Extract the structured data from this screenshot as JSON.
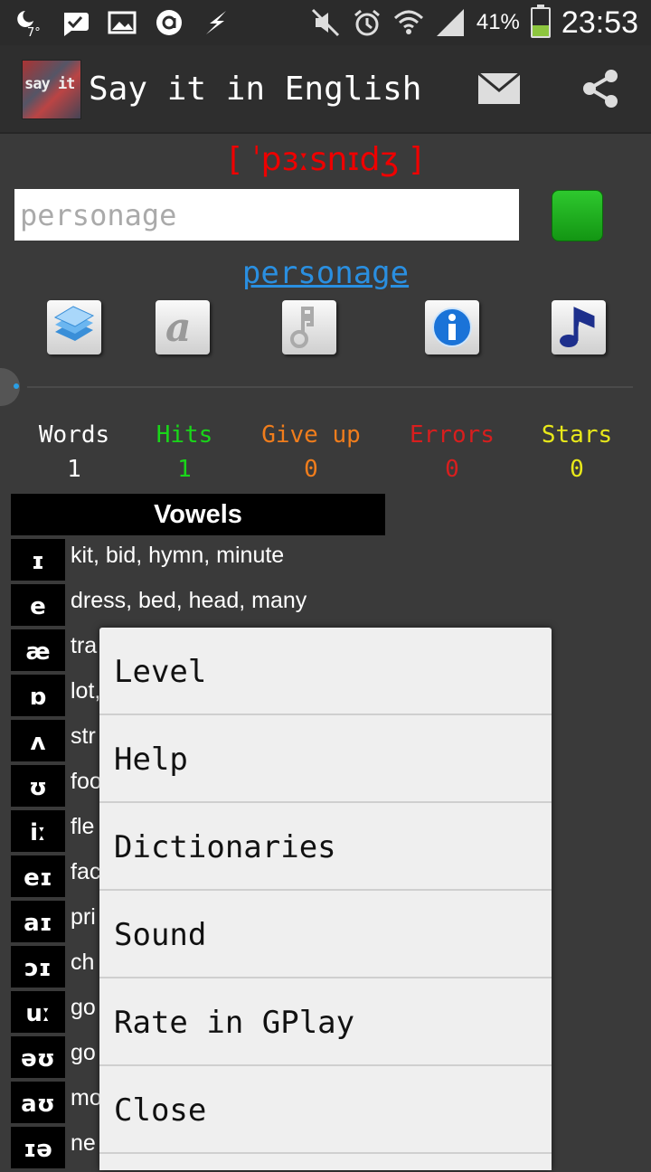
{
  "status_bar": {
    "temperature": "7°",
    "battery_percent": "41%",
    "battery_level": 0.41,
    "time": "23:53",
    "icons": [
      "weather-icon",
      "bbm-icon",
      "gallery-icon",
      "circle-a-icon",
      "flash-icon",
      "mute-icon",
      "alarm-icon",
      "wifi-icon",
      "signal-icon",
      "battery-icon"
    ]
  },
  "action_bar": {
    "logo_text": "say it",
    "title": "Say it in English",
    "actions": [
      "mail-icon",
      "share-icon"
    ]
  },
  "main": {
    "ipa": "[ ˈpɜːsnɪdʒ ]",
    "input_value": "personage",
    "link_word": "personage",
    "tools": [
      "books-icon",
      "at-sign-icon",
      "key-icon",
      "info-icon",
      "music-note-icon"
    ]
  },
  "stats": [
    {
      "label": "Words",
      "value": "1",
      "color": "#ffffff"
    },
    {
      "label": "Hits",
      "value": "1",
      "color": "#19d619"
    },
    {
      "label": "Give up",
      "value": "0",
      "color": "#f07d1c"
    },
    {
      "label": "Errors",
      "value": "0",
      "color": "#d81e1e"
    },
    {
      "label": "Stars",
      "value": "0",
      "color": "#e8e81a"
    }
  ],
  "vowels": {
    "title": "Vowels",
    "rows": [
      {
        "symbol": "ɪ",
        "examples": "kit, bid, hymn, minute"
      },
      {
        "symbol": "e",
        "examples": "dress, bed, head, many"
      },
      {
        "symbol": "æ",
        "examples": "tra"
      },
      {
        "symbol": "ɒ",
        "examples": "lot,"
      },
      {
        "symbol": "ʌ",
        "examples": "str"
      },
      {
        "symbol": "ʊ",
        "examples": "foo"
      },
      {
        "symbol": "iː",
        "examples": "fle"
      },
      {
        "symbol": "eɪ",
        "examples": "fac"
      },
      {
        "symbol": "aɪ",
        "examples": "pri"
      },
      {
        "symbol": "ɔɪ",
        "examples": "ch"
      },
      {
        "symbol": "uː",
        "examples": "go"
      },
      {
        "symbol": "əʊ",
        "examples": "go"
      },
      {
        "symbol": "aʊ",
        "examples": "mo"
      },
      {
        "symbol": "ɪə",
        "examples": "ne"
      }
    ]
  },
  "menu": {
    "items": [
      "Level",
      "Help",
      "Dictionaries",
      "Sound",
      "Rate in GPlay",
      "Close"
    ]
  }
}
